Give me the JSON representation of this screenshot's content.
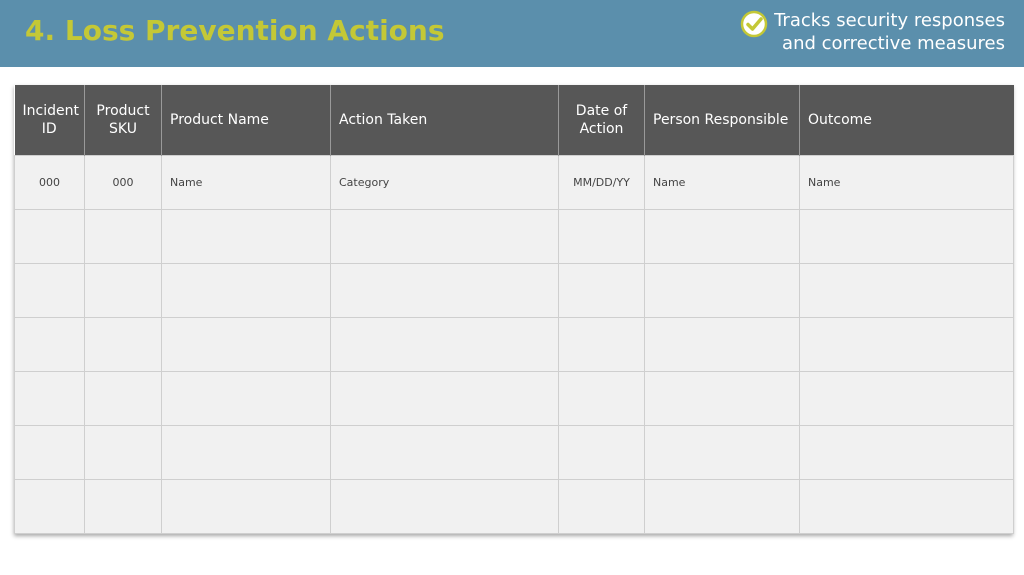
{
  "header": {
    "title": "4. Loss Prevention Actions",
    "note_line1": "Tracks security responses",
    "note_line2": "and corrective measures",
    "accent_color": "#c4c836",
    "bar_color": "#5b8fac",
    "icon": "checkmark-circle-icon"
  },
  "table": {
    "columns": [
      {
        "line1": "Incident",
        "line2": "ID"
      },
      {
        "line1": "Product",
        "line2": "SKU"
      },
      {
        "line1": "Product Name",
        "line2": ""
      },
      {
        "line1": "Action Taken",
        "line2": ""
      },
      {
        "line1": "Date of",
        "line2": "Action"
      },
      {
        "line1": "Person Responsible",
        "line2": ""
      },
      {
        "line1": "Outcome",
        "line2": ""
      }
    ],
    "rows": [
      [
        "000",
        "000",
        "Name",
        "Category",
        "MM/DD/YY",
        "Name",
        "Name"
      ],
      [
        "",
        "",
        "",
        "",
        "",
        "",
        ""
      ],
      [
        "",
        "",
        "",
        "",
        "",
        "",
        ""
      ],
      [
        "",
        "",
        "",
        "",
        "",
        "",
        ""
      ],
      [
        "",
        "",
        "",
        "",
        "",
        "",
        ""
      ],
      [
        "",
        "",
        "",
        "",
        "",
        "",
        ""
      ],
      [
        "",
        "",
        "",
        "",
        "",
        "",
        ""
      ]
    ]
  }
}
